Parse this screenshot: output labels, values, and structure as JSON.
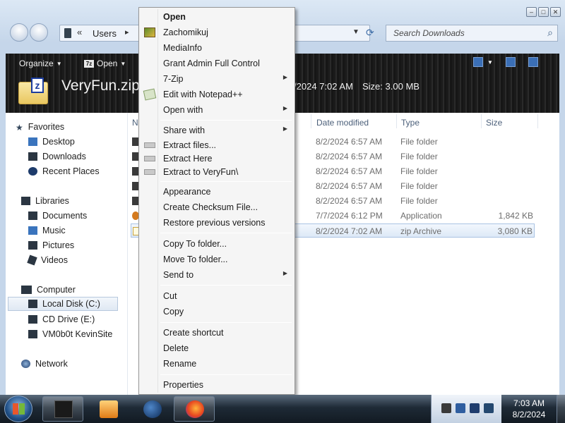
{
  "address": {
    "crumb_chevron": "«",
    "crumb": "Users",
    "crumb_sep": "▸",
    "dropdown": "▼",
    "refresh_icon": "⟳"
  },
  "search": {
    "placeholder": "Search Downloads"
  },
  "toolbar": {
    "organize": "Organize",
    "open": "Open",
    "zip_badge": "7z"
  },
  "details_header": {
    "file_name": "VeryFun.zip",
    "date_modified": "8/2/2024 7:02 AM",
    "size_label": "Size:",
    "size_value": "3.00 MB"
  },
  "navpane": {
    "favorites": "Favorites",
    "desktop": "Desktop",
    "downloads": "Downloads",
    "recent_places": "Recent Places",
    "libraries": "Libraries",
    "documents": "Documents",
    "music": "Music",
    "pictures": "Pictures",
    "videos": "Videos",
    "computer": "Computer",
    "local_disk": "Local Disk (C:)",
    "cd_drive": "CD Drive (E:)",
    "vm_site": "VM0b0t KevinSite",
    "network": "Network"
  },
  "columns": {
    "name": "Na",
    "date_modified": "Date modified",
    "type": "Type",
    "size": "Size"
  },
  "files": [
    {
      "date": "8/2/2024 6:57 AM",
      "type": "File folder",
      "size": ""
    },
    {
      "date": "8/2/2024 6:57 AM",
      "type": "File folder",
      "size": ""
    },
    {
      "date": "8/2/2024 6:57 AM",
      "type": "File folder",
      "size": ""
    },
    {
      "date": "8/2/2024 6:57 AM",
      "type": "File folder",
      "size": ""
    },
    {
      "date": "8/2/2024 6:57 AM",
      "type": "File folder",
      "size": ""
    },
    {
      "date": "7/7/2024 6:12 PM",
      "type": "Application",
      "size": "1,842 KB"
    },
    {
      "date": "8/2/2024 7:02 AM",
      "type": "zip Archive",
      "size": "3,080 KB"
    }
  ],
  "context_menu": {
    "open": "Open",
    "zachomikuj": "Zachomikuj",
    "mediainfo": "MediaInfo",
    "grant_admin": "Grant Admin Full Control",
    "seven_zip": "7-Zip",
    "edit_notepad": "Edit with Notepad++",
    "open_with": "Open with",
    "share_with": "Share with",
    "extract_files": "Extract files...",
    "extract_here": "Extract Here",
    "extract_to": "Extract to VeryFun\\",
    "appearance": "Appearance",
    "create_checksum": "Create Checksum File...",
    "restore_versions": "Restore previous versions",
    "copy_to_folder": "Copy To folder...",
    "move_to_folder": "Move To folder...",
    "send_to": "Send to",
    "cut": "Cut",
    "copy": "Copy",
    "create_shortcut": "Create shortcut",
    "delete": "Delete",
    "rename": "Rename",
    "properties": "Properties"
  },
  "taskbar": {
    "time": "7:03 AM",
    "date": "8/2/2024"
  },
  "colors": {
    "toolbar_bg": "#1b1b1b",
    "menu_bg": "#f5f5f5",
    "selection": "#dde9f7",
    "taskbar": "#1e2a36"
  }
}
